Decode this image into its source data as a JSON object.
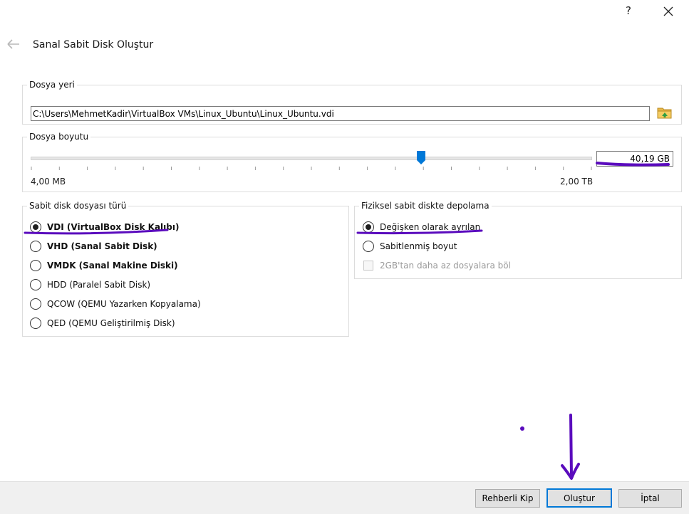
{
  "titlebar": {
    "help_label": "?",
    "close_icon": "close-icon"
  },
  "wizard": {
    "title": "Sanal Sabit Disk Oluştur",
    "back_icon": "arrow-left-icon"
  },
  "file_location": {
    "group_title": "Dosya yeri",
    "path": "C:\\Users\\MehmetKadir\\VirtualBox VMs\\Linux_Ubuntu\\Linux_Ubuntu.vdi",
    "browse_icon": "folder-icon"
  },
  "file_size": {
    "group_title": "Dosya boyutu",
    "min_label": "4,00 MB",
    "max_label": "2,00 TB",
    "value": "40,19 GB",
    "slider_fraction": 0.695
  },
  "disk_type": {
    "group_title": "Sabit disk dosyası türü",
    "options": [
      {
        "label": "VDI (VirtualBox Disk Kalıbı)",
        "checked": true,
        "bold": true
      },
      {
        "label": "VHD (Sanal Sabit Disk)",
        "checked": false,
        "bold": true
      },
      {
        "label": "VMDK (Sanal Makine Diski)",
        "checked": false,
        "bold": true
      },
      {
        "label": "HDD (Paralel Sabit Disk)",
        "checked": false,
        "bold": false
      },
      {
        "label": "QCOW (QEMU Yazarken Kopyalama)",
        "checked": false,
        "bold": false
      },
      {
        "label": "QED (QEMU Geliştirilmiş Disk)",
        "checked": false,
        "bold": false
      }
    ]
  },
  "storage": {
    "group_title": "Fiziksel sabit diskte depolama",
    "options": [
      {
        "label": "Değişken olarak ayrılan",
        "checked": true
      },
      {
        "label": "Sabitlenmiş boyut",
        "checked": false
      }
    ],
    "split_label": "2GB'tan daha az dosyalara böl",
    "split_enabled": false
  },
  "footer": {
    "expert_label": "Rehberli Kip",
    "create_label": "Oluştur",
    "cancel_label": "İptal"
  },
  "colors": {
    "annotation": "#5a0bbd",
    "accent": "#0078d7"
  }
}
